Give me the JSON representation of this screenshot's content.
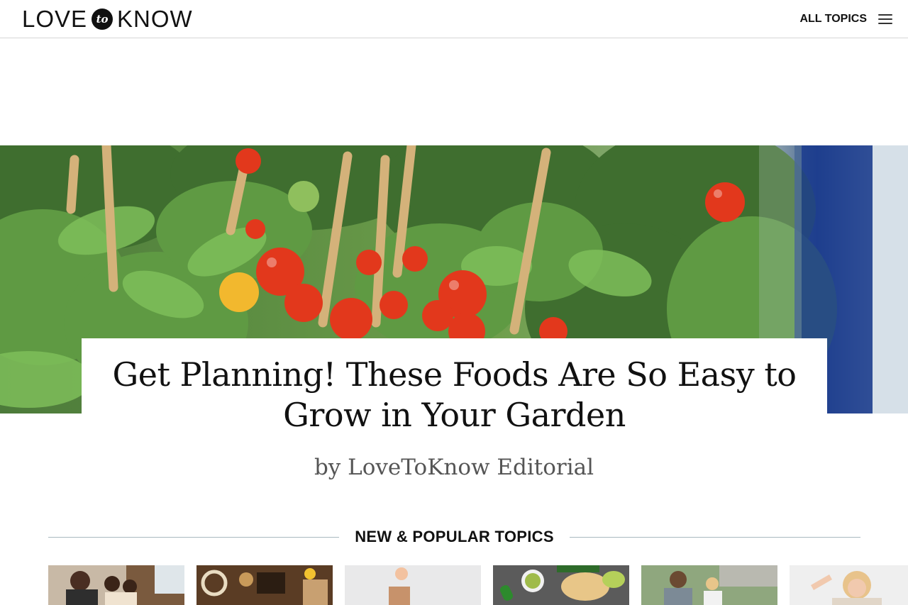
{
  "header": {
    "logo": {
      "left": "LOVE",
      "badge": "to",
      "right": "KNOW"
    },
    "all_topics_label": "ALL TOPICS",
    "menu_icon": "hamburger-menu-icon"
  },
  "article": {
    "title": "Get Planning! These Foods Are So Easy to Grow in Your Garden",
    "byline": "by LoveToKnow Editorial"
  },
  "topics_section": {
    "heading": "NEW & POPULAR TOPICS"
  },
  "colors": {
    "text": "#111111",
    "byline": "#555555",
    "rule": "#a9b8bf",
    "header_border": "#d6d6d6"
  }
}
